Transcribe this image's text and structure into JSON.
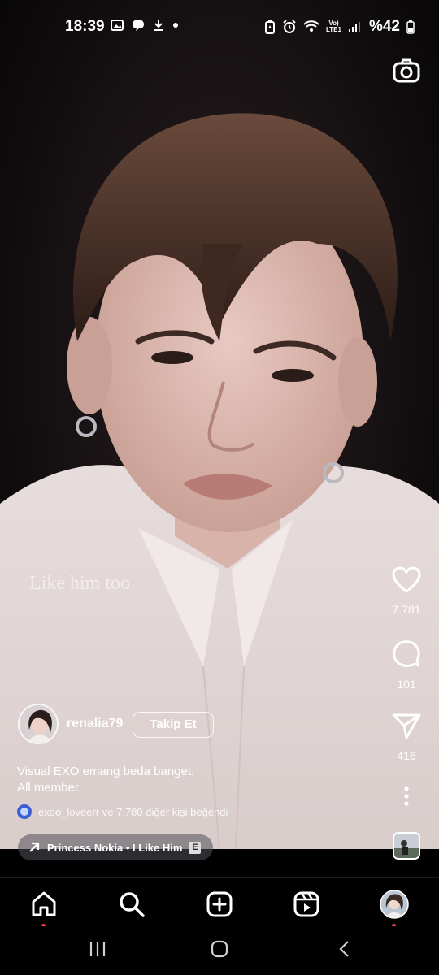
{
  "status_bar": {
    "time": "18:39",
    "network_label": "Vo)\nLTE1",
    "battery": "%42"
  },
  "video": {
    "overlay_text": "Like him too",
    "accent_bg": "#e9e1de"
  },
  "actions": {
    "likes": "7.781",
    "comments": "101",
    "shares": "416"
  },
  "author": {
    "username": "renalia79",
    "follow_label": "Takip Et"
  },
  "caption": {
    "line1": "Visual EXO emang beda banget.",
    "line2": "All member."
  },
  "likers": {
    "text": "exoo_loveerr ve 7.780 diğer kişi beğendi"
  },
  "audio": {
    "label": "Princess Nokia • I Like Him",
    "explicit": "E"
  },
  "icons": {
    "camera": "camera-icon",
    "like": "heart-icon",
    "comment": "comment-icon",
    "share": "send-icon",
    "more": "more-vertical-icon",
    "home": "home-icon",
    "search": "search-icon",
    "create": "plus-square-icon",
    "reels": "reels-icon",
    "profile": "profile-avatar"
  },
  "colors": {
    "notification_dot": "#ff3040"
  }
}
